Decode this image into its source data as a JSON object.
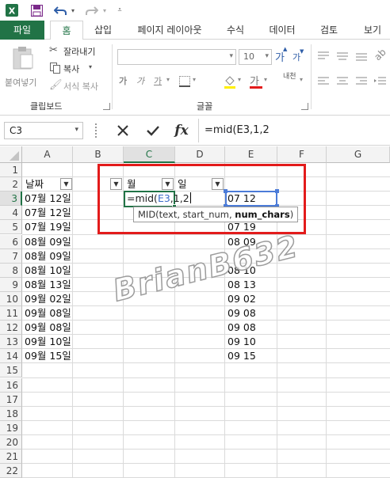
{
  "qat": {
    "app_icon": "excel-icon",
    "save_icon": "save-icon",
    "undo_icon": "undo-icon",
    "redo_icon": "redo-icon",
    "customize_icon": "customize-icon"
  },
  "tabs": [
    {
      "label": "파일"
    },
    {
      "label": "홈"
    },
    {
      "label": "삽입"
    },
    {
      "label": "페이지 레이아웃"
    },
    {
      "label": "수식"
    },
    {
      "label": "데이터"
    },
    {
      "label": "검토"
    },
    {
      "label": "보기"
    }
  ],
  "ribbon": {
    "paste_label": "붙여넣기",
    "cut_label": "잘라내기",
    "copy_label": "복사",
    "format_painter_label": "서식 복사",
    "clipboard_group": "클립보드",
    "font_size": "10",
    "grow_font": "가",
    "shrink_font": "가",
    "bold": "가",
    "italic": "가",
    "underline": "가",
    "font_color": "가",
    "phonetic": "내천",
    "font_group": "글꼴"
  },
  "formula_bar": {
    "name_box": "C3",
    "fx_label": "fx",
    "formula": "=mid(E3,1,2"
  },
  "columns": [
    "A",
    "B",
    "C",
    "D",
    "E",
    "F",
    "G"
  ],
  "rows": [
    "1",
    "2",
    "3",
    "4",
    "5",
    "6",
    "7",
    "8",
    "9",
    "10",
    "11",
    "12",
    "13",
    "14",
    "15",
    "16",
    "17",
    "18",
    "19",
    "20",
    "21",
    "22"
  ],
  "headers": {
    "A": "날짜",
    "C": "월",
    "D": "일"
  },
  "column_a": [
    "07월 12일",
    "07월 12일",
    "07월 19일",
    "08월 09일",
    "08월 09일",
    "08월 10일",
    "08월 13일",
    "09월 02일",
    "09월 08일",
    "09월 08일",
    "09월 10일",
    "09월 15일"
  ],
  "column_e": [
    "07 12",
    "",
    "07 19",
    "08 09",
    "08 10",
    "08 13",
    "09 02",
    "09 08",
    "09 08",
    "09 10",
    "09 15"
  ],
  "editing": {
    "prefix": "=mid(",
    "ref": "E3",
    "suffix": ",1,2"
  },
  "tooltip": {
    "prefix": "MID(text, start_num, ",
    "bold": "num_chars",
    "suffix": ")"
  },
  "watermark": "BrianB632",
  "colors": {
    "accent": "#217346",
    "highlight_box": "#e31b1b",
    "reference": "#4b7bd8"
  }
}
